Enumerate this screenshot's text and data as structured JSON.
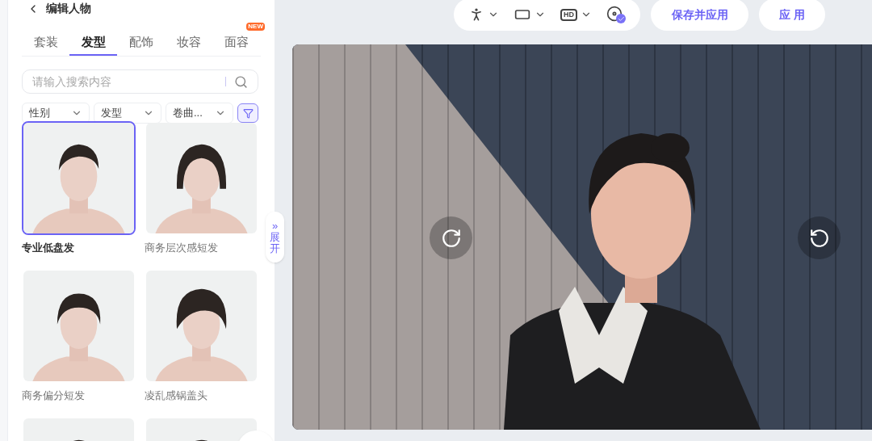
{
  "header": {
    "title": "编辑人物"
  },
  "tabs": [
    {
      "label": "套装",
      "selected": false
    },
    {
      "label": "发型",
      "selected": true
    },
    {
      "label": "配饰",
      "selected": false
    },
    {
      "label": "妆容",
      "selected": false
    },
    {
      "label": "面容",
      "selected": false,
      "badge": "NEW"
    }
  ],
  "search": {
    "placeholder": "请输入搜索内容"
  },
  "filters": [
    "性别",
    "发型",
    "卷曲..."
  ],
  "items": [
    {
      "name": "专业低盘发",
      "selected": true
    },
    {
      "name": "商务层次感短发",
      "selected": false
    },
    {
      "name": "商务偏分短发",
      "selected": false
    },
    {
      "name": "凌乱感锅盖头",
      "selected": false
    },
    {
      "selected": false
    },
    {
      "selected": false
    }
  ],
  "expand_toggle": {
    "arrow": "»",
    "label": "展开"
  },
  "toolbar": {
    "quality": "HD"
  },
  "buttons": [
    "保存并应用",
    "应 用"
  ]
}
